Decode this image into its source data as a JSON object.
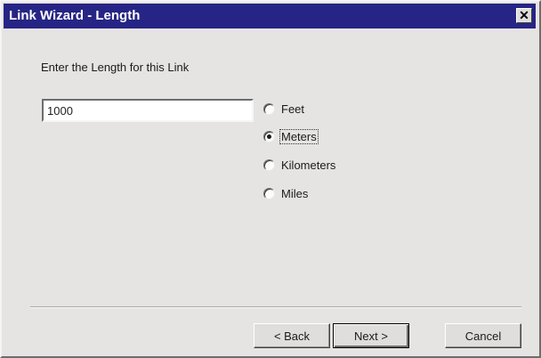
{
  "window": {
    "title": "Link Wizard - Length",
    "close_glyph": "✕"
  },
  "prompt": "Enter the Length for this Link",
  "length_input": {
    "value": "1000"
  },
  "units": [
    {
      "label": "Feet",
      "checked": false
    },
    {
      "label": "Meters",
      "checked": true
    },
    {
      "label": "Kilometers",
      "checked": false
    },
    {
      "label": "Miles",
      "checked": false
    }
  ],
  "buttons": {
    "back": "< Back",
    "next": "Next >",
    "cancel": "Cancel"
  },
  "colors": {
    "titlebar": "#262585",
    "dialog_bg": "#e6e4e3"
  }
}
